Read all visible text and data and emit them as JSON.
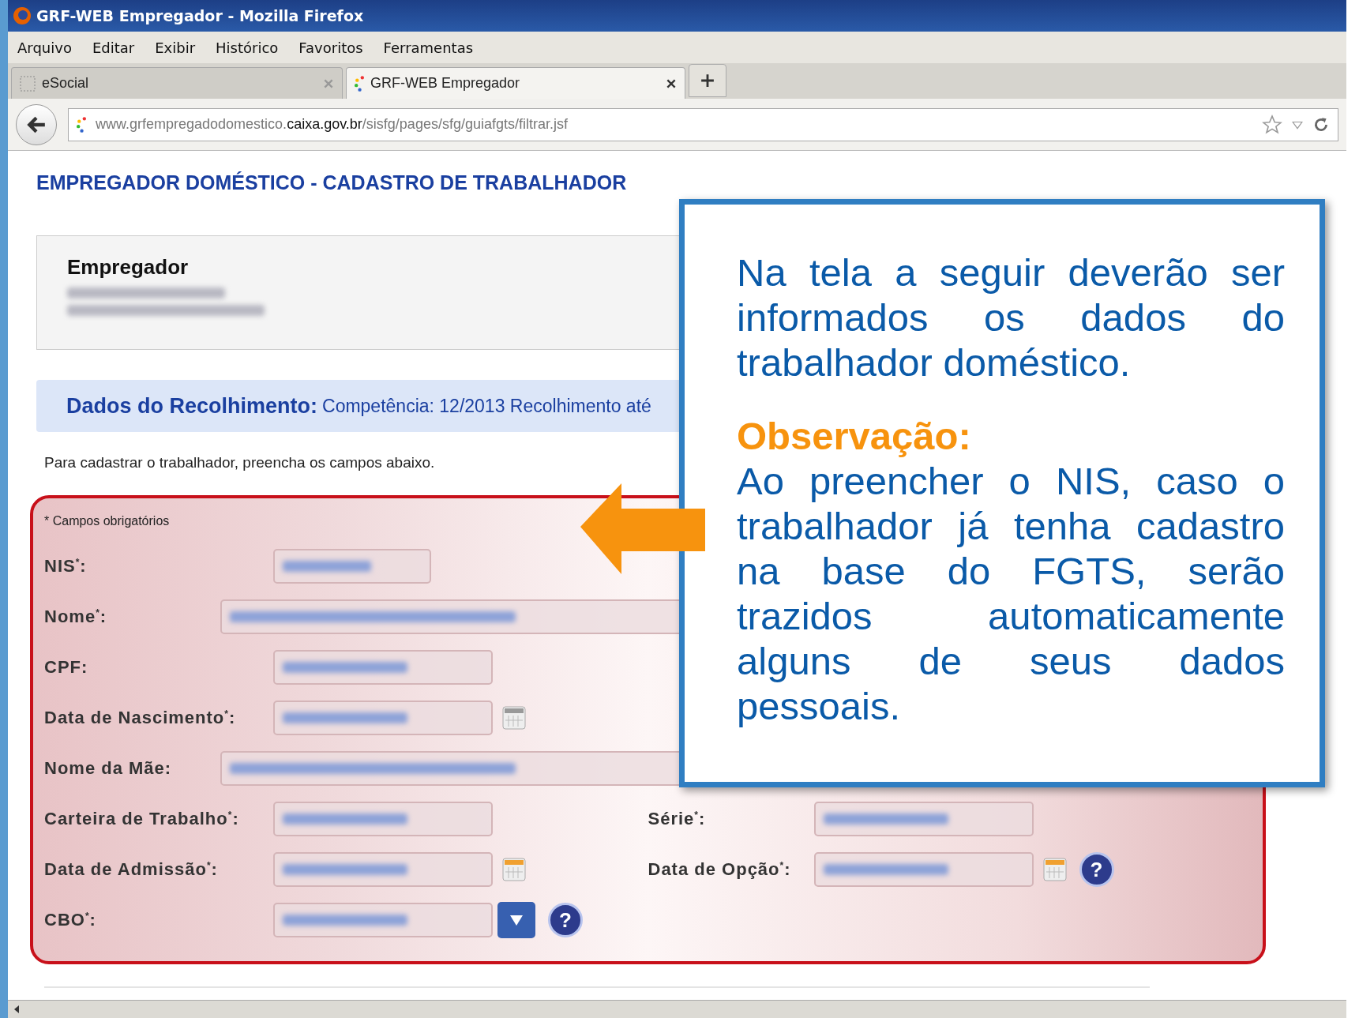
{
  "window": {
    "title": "GRF-WEB Empregador - Mozilla Firefox"
  },
  "menu": [
    "Arquivo",
    "Editar",
    "Exibir",
    "Histórico",
    "Favoritos",
    "Ferramentas"
  ],
  "tabs": [
    {
      "label": "eSocial",
      "selected": false
    },
    {
      "label": "GRF-WEB Empregador",
      "selected": true
    }
  ],
  "address_bar": {
    "url": "www.grfempregadodomestico.**caixa.gov.br**/sisfg/pages/sfg/guiafgts/filtrar.jsf"
  },
  "page": {
    "heading": "EMPREGADOR DOMÉSTICO - CADASTRO DE TRABALHADOR",
    "employer": {
      "title": "Empregador"
    },
    "collection": {
      "label": "Dados do Recolhimento:",
      "details": "Competência: 12/2013  Recolhimento até"
    },
    "instruction": "Para cadastrar o trabalhador, preencha os campos abaixo.",
    "form": {
      "note": "* Campos obrigatórios",
      "rows": [
        {
          "fields": [
            {
              "label": "NIS$^{*}$:",
              "kind": "short"
            }
          ]
        },
        {
          "fields": [
            {
              "label": "Nome$^{*}$:",
              "kind": "wide"
            }
          ]
        },
        {
          "fields": [
            {
              "label": "CPF:",
              "kind": "text"
            }
          ]
        },
        {
          "fields": [
            {
              "label": "Data de Nascimento$^{*}$:",
              "kind": "date",
              "calendar_enabled": false
            }
          ]
        },
        {
          "fields": [
            {
              "label": "Nome da Mãe:",
              "kind": "wide"
            }
          ]
        },
        {
          "fields": [
            {
              "label": "Carteira de Trabalho$^{*}$:",
              "kind": "text"
            },
            {
              "label": "Série$^{*}$:",
              "kind": "text"
            }
          ]
        },
        {
          "fields": [
            {
              "label": "Data de Admissão$^{*}$:",
              "kind": "date",
              "calendar_enabled": true
            },
            {
              "label": "Data de Opção$^{*}$:",
              "kind": "date",
              "calendar_enabled": true,
              "help": "?"
            }
          ]
        },
        {
          "fields": [
            {
              "label": "CBO$^{*}$:",
              "kind": "select",
              "help": "?"
            }
          ]
        }
      ]
    }
  },
  "callout": {
    "text": "Na tela a seguir deverão ser informados os dados do trabalhador doméstico.",
    "note_title": "Observação:",
    "note_text": "Ao preencher o NIS, caso o trabalhador já tenha cadastro na base do FGTS, serão trazidos automaticamente alguns de seus dados pessoais."
  }
}
